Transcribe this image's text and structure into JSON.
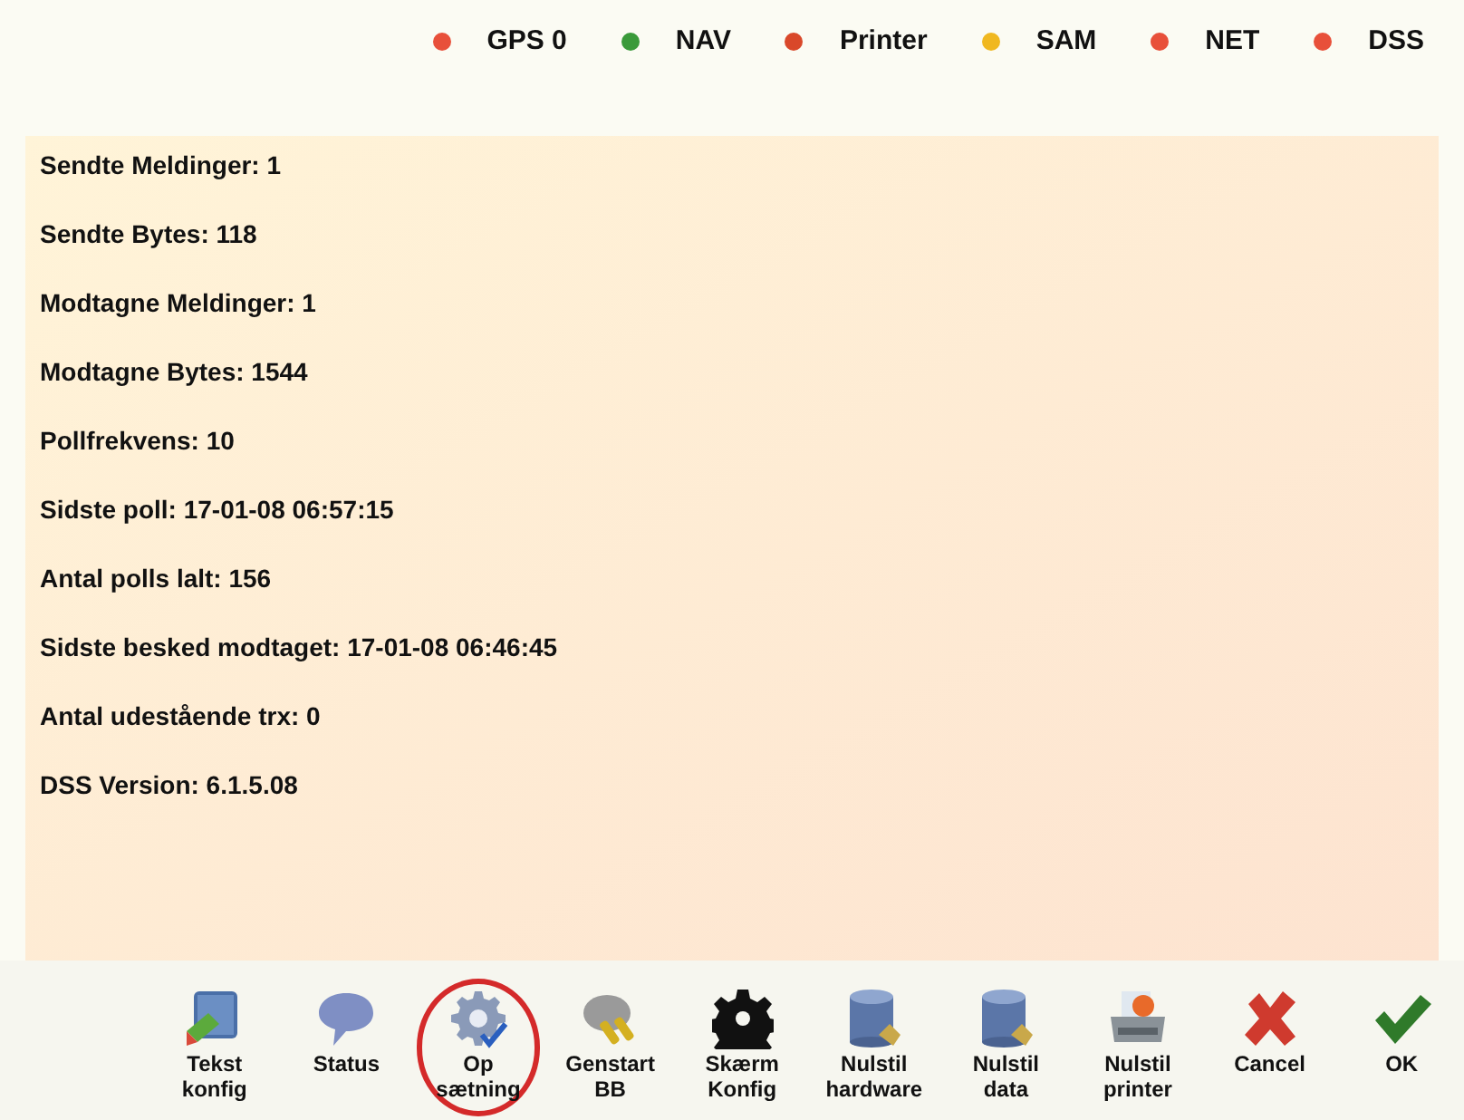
{
  "status_indicators": [
    {
      "label": "GPS 0",
      "color": "#e8503a"
    },
    {
      "label": "NAV",
      "color": "#3a9a3a"
    },
    {
      "label": "Printer",
      "color": "#d9482a"
    },
    {
      "label": "SAM",
      "color": "#f0b820"
    },
    {
      "label": "NET",
      "color": "#e8503a"
    },
    {
      "label": "DSS",
      "color": "#e8503a"
    }
  ],
  "info_lines": [
    "Sendte Meldinger: 1",
    "Sendte Bytes: 118",
    "Modtagne Meldinger: 1",
    "Modtagne Bytes: 1544",
    "Pollfrekvens: 10",
    "Sidste poll: 17-01-08 06:57:15",
    "Antal polls lalt: 156",
    "Sidste besked modtaget: 17-01-08 06:46:45",
    "Antal udestående trx: 0",
    "DSS Version: 6.1.5.08"
  ],
  "toolbar": [
    {
      "kind": "db-pencil",
      "label": "Tekst\nkonfig",
      "selected": false
    },
    {
      "kind": "speech",
      "label": "Status",
      "selected": false
    },
    {
      "kind": "gear",
      "label": "Op\nsætning",
      "selected": true
    },
    {
      "kind": "plug",
      "label": "Genstart\nBB",
      "selected": false
    },
    {
      "kind": "gear-black",
      "label": "Skærm\nKonfig",
      "selected": false
    },
    {
      "kind": "database",
      "label": "Nulstil\nhardware",
      "selected": false
    },
    {
      "kind": "database",
      "label": "Nulstil\ndata",
      "selected": false
    },
    {
      "kind": "printer",
      "label": "Nulstil\nprinter",
      "selected": false
    },
    {
      "kind": "cross",
      "label": "Cancel",
      "selected": false
    },
    {
      "kind": "check",
      "label": "OK",
      "selected": false
    }
  ]
}
